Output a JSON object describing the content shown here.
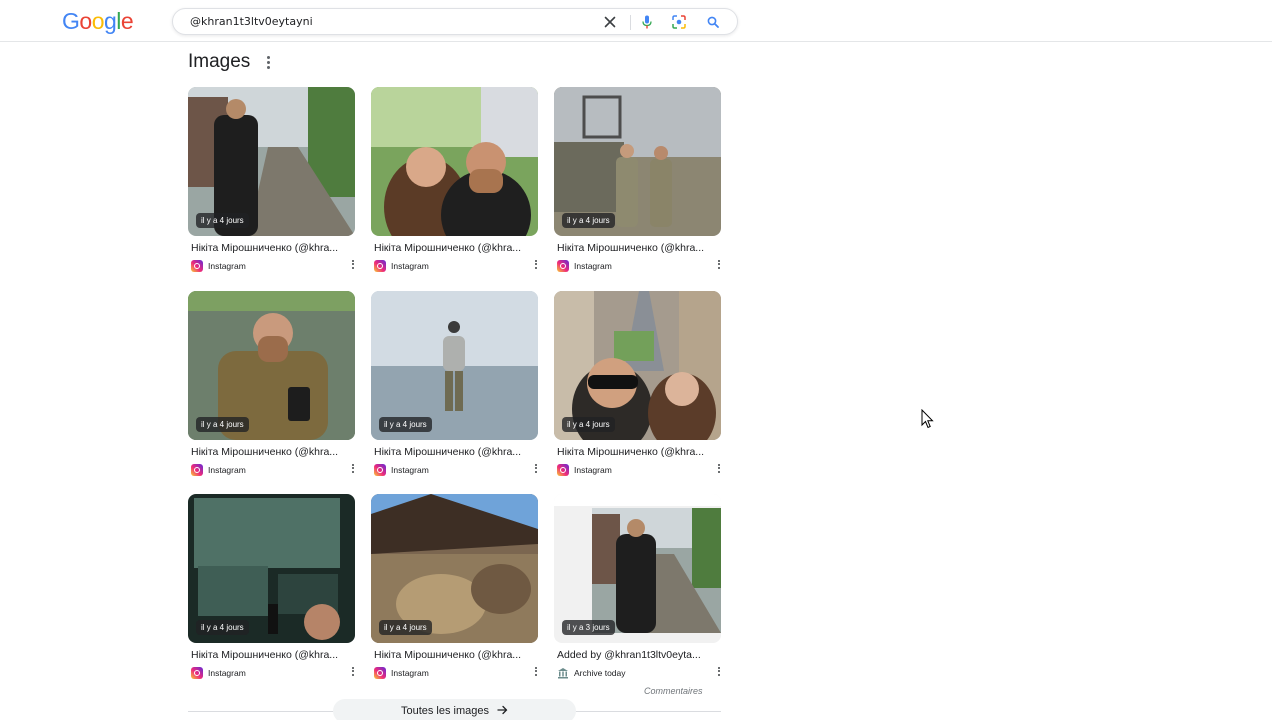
{
  "header": {
    "logo": "Google",
    "logo_colors": [
      "#4285F4",
      "#EA4335",
      "#FBBC05",
      "#4285F4",
      "#34A853",
      "#EA4335"
    ],
    "search_query": "@khran1t3ltv0eytayni",
    "clear_icon": "close-icon",
    "voice_icon": "mic-icon",
    "lens_icon": "lens-icon",
    "search_icon": "search-icon"
  },
  "section": {
    "title": "Images",
    "more_icon": "more-vert-icon"
  },
  "images": [
    {
      "title": "Нікіта Мірошниченко (@khra...",
      "source": "Instagram",
      "badge": "il y a 4 jours",
      "source_icon": "instagram-icon"
    },
    {
      "title": "Нікіта Мірошниченко (@khra...",
      "source": "Instagram",
      "badge": "",
      "source_icon": "instagram-icon"
    },
    {
      "title": "Нікіта Мірошниченко (@khra...",
      "source": "Instagram",
      "badge": "il y a 4 jours",
      "source_icon": "instagram-icon"
    },
    {
      "title": "Нікіта Мірошниченко (@khra...",
      "source": "Instagram",
      "badge": "il y a 4 jours",
      "source_icon": "instagram-icon"
    },
    {
      "title": "Нікіта Мірошниченко (@khra...",
      "source": "Instagram",
      "badge": "il y a 4 jours",
      "source_icon": "instagram-icon"
    },
    {
      "title": "Нікіта Мірошниченко (@khra...",
      "source": "Instagram",
      "badge": "il y a 4 jours",
      "source_icon": "instagram-icon"
    },
    {
      "title": "Нікіта Мірошниченко (@khra...",
      "source": "Instagram",
      "badge": "il y a 4 jours",
      "source_icon": "instagram-icon"
    },
    {
      "title": "Нікіта Мірошниченко (@khra...",
      "source": "Instagram",
      "badge": "il y a 4 jours",
      "source_icon": "instagram-icon"
    },
    {
      "title": "Added by @khran1t3ltv0eyta...",
      "source": "Archive today",
      "badge": "il y a 3 jours",
      "source_icon": "archive-icon"
    }
  ],
  "footer": {
    "comments_label": "Commentaires",
    "all_images_label": "Toutes les images",
    "arrow_icon": "arrow-right-icon"
  },
  "colors": {
    "badge_bg": "#202124",
    "border": "#dadce0",
    "pill_bg": "#f1f3f4"
  }
}
